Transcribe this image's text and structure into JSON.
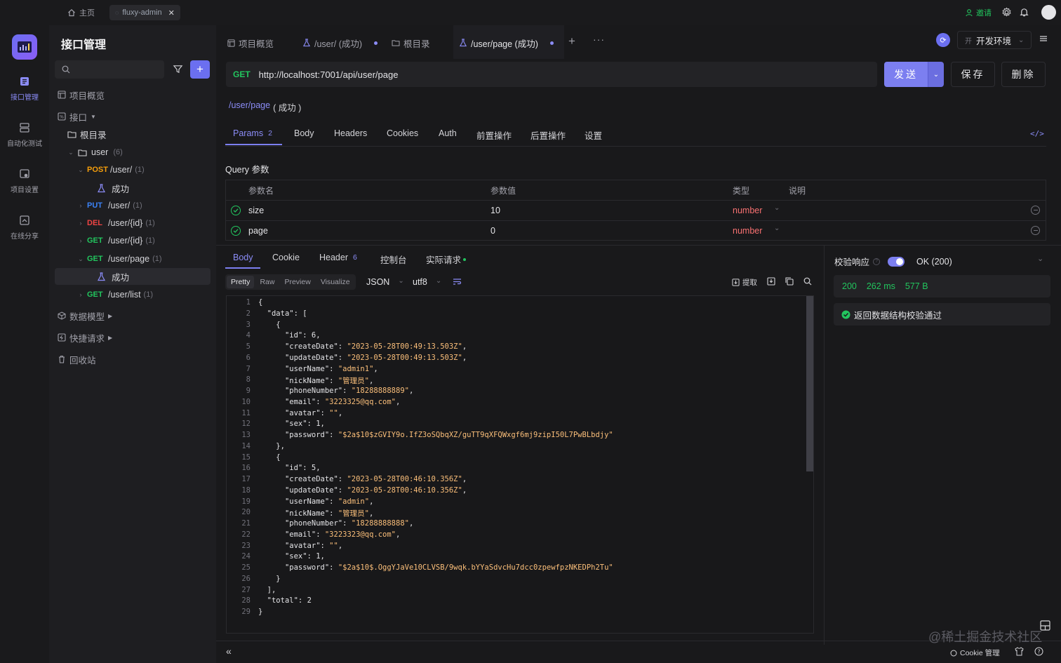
{
  "topbar": {
    "home_label": "主页",
    "tab_label": "fluxy-admin",
    "invite_label": "邀请"
  },
  "rail": {
    "items": [
      {
        "label": "接口管理"
      },
      {
        "label": "自动化测试"
      },
      {
        "label": "项目设置"
      },
      {
        "label": "在线分享"
      }
    ]
  },
  "sidebar": {
    "title": "接口管理",
    "overview": "项目概览",
    "api_section": "接口",
    "root_folder": "根目录",
    "user_folder": "user",
    "user_count": "(6)",
    "endpoints": [
      {
        "method": "POST",
        "path": "/user/",
        "count": "(1)"
      },
      {
        "example": "成功"
      },
      {
        "method": "PUT",
        "path": "/user/",
        "count": "(1)"
      },
      {
        "method": "DEL",
        "path": "/user/{id}",
        "count": "(1)"
      },
      {
        "method": "GET",
        "path": "/user/{id}",
        "count": "(1)"
      },
      {
        "method": "GET",
        "path": "/user/page",
        "count": "(1)"
      },
      {
        "example": "成功"
      },
      {
        "method": "GET",
        "path": "/user/list",
        "count": "(1)"
      }
    ],
    "data_model": "数据模型",
    "quick_request": "快捷请求",
    "recycle_bin": "回收站"
  },
  "tabs": [
    {
      "label": "项目概览"
    },
    {
      "label": "/user/ (成功)"
    },
    {
      "label": "根目录"
    },
    {
      "label": "/user/page (成功)"
    }
  ],
  "env": {
    "badge": "开",
    "label": "开发环境"
  },
  "request": {
    "method": "GET",
    "url": "http://localhost:7001/api/user/page",
    "send": "发送",
    "save": "保存",
    "delete": "删除",
    "breadcrumb_path": "/user/page",
    "breadcrumb_status": "( 成功 )"
  },
  "req_tabs": [
    {
      "label": "Params",
      "count": "2"
    },
    {
      "label": "Body"
    },
    {
      "label": "Headers"
    },
    {
      "label": "Cookies"
    },
    {
      "label": "Auth"
    },
    {
      "label": "前置操作"
    },
    {
      "label": "后置操作"
    },
    {
      "label": "设置"
    }
  ],
  "query": {
    "title": "Query 参数",
    "headers": [
      "参数名",
      "参数值",
      "类型",
      "说明"
    ],
    "rows": [
      {
        "name": "size",
        "value": "10",
        "type": "number"
      },
      {
        "name": "page",
        "value": "0",
        "type": "number"
      }
    ]
  },
  "resp_tabs": [
    {
      "label": "Body"
    },
    {
      "label": "Cookie"
    },
    {
      "label": "Header",
      "count": "6"
    },
    {
      "label": "控制台"
    },
    {
      "label": "实际请求"
    }
  ],
  "view_modes": [
    "Pretty",
    "Raw",
    "Preview",
    "Visualize"
  ],
  "format": "JSON",
  "encoding": "utf8",
  "extract_label": "提取",
  "code_lines": [
    "{",
    "  \"data\": [",
    "    {",
    "      \"id\": 6,",
    "      \"createDate\": \"2023-05-28T00:49:13.503Z\",",
    "      \"updateDate\": \"2023-05-28T00:49:13.503Z\",",
    "      \"userName\": \"admin1\",",
    "      \"nickName\": \"管理员\",",
    "      \"phoneNumber\": \"18288888889\",",
    "      \"email\": \"3223325@qq.com\",",
    "      \"avatar\": \"\",",
    "      \"sex\": 1,",
    "      \"password\": \"$2a$10$zGVIY9o.IfZ3oSQbqXZ/guTT9qXFQWxgf6mj9zipI50L7PwBLbdjy\"",
    "    },",
    "    {",
    "      \"id\": 5,",
    "      \"createDate\": \"2023-05-28T00:46:10.356Z\",",
    "      \"updateDate\": \"2023-05-28T00:46:10.356Z\",",
    "      \"userName\": \"admin\",",
    "      \"nickName\": \"管理员\",",
    "      \"phoneNumber\": \"18288888888\",",
    "      \"email\": \"3223323@qq.com\",",
    "      \"avatar\": \"\",",
    "      \"sex\": 1,",
    "      \"password\": \"$2a$10$.OggYJaVe10CLVSB/9wqk.bYYaSdvcHu7dcc0zpewfpzNKEDPh2Tu\"",
    "    }",
    "  ],",
    "  \"total\": 2",
    "}"
  ],
  "validate": {
    "label": "校验响应",
    "status": "OK (200)",
    "code": "200",
    "time": "262 ms",
    "size": "577 B",
    "result": "返回数据结构校验通过"
  },
  "footer": {
    "cookie_label": "Cookie 管理",
    "watermark": "@稀土掘金技术社区"
  },
  "colors": {
    "accent": "#7c7ff0",
    "success": "#22c55e",
    "string": "#fbbf7a"
  }
}
